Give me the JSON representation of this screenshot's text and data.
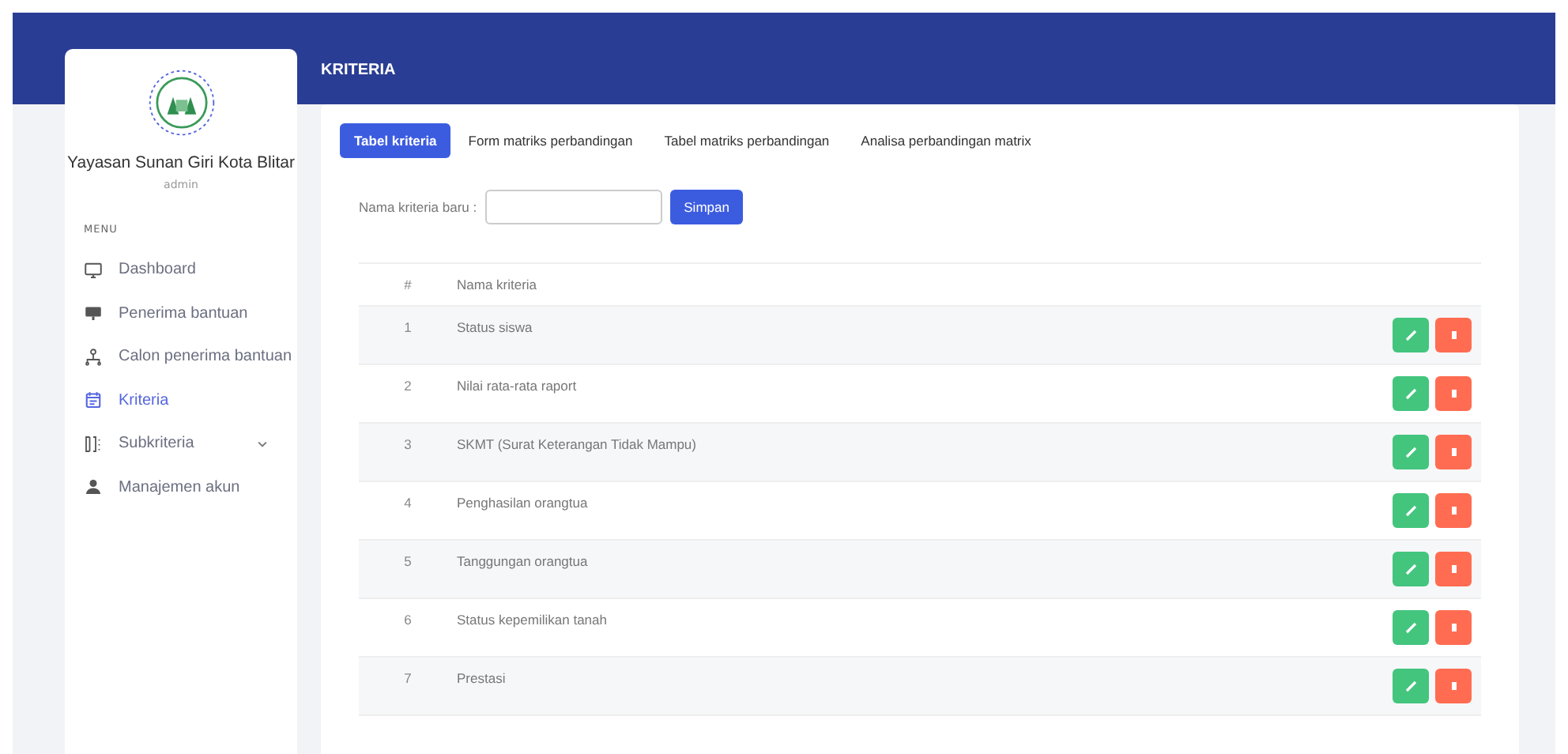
{
  "sidebar": {
    "org_name": "Yayasan Sunan Giri Kota Blitar",
    "role": "admin",
    "menu_heading": "MENU",
    "items": [
      {
        "label": "Dashboard",
        "kind": "monitor",
        "selected": false
      },
      {
        "label": "Penerima bantuan",
        "kind": "presentation",
        "selected": false
      },
      {
        "label": "Calon penerima bantuan",
        "kind": "network",
        "selected": false
      },
      {
        "label": "Kriteria",
        "kind": "calendar",
        "selected": true
      },
      {
        "label": "Subkriteria",
        "kind": "columns",
        "selected": false,
        "expanded": false
      },
      {
        "label": "Manajemen akun",
        "kind": "user",
        "selected": false
      }
    ]
  },
  "header": {
    "title": "KRITERIA"
  },
  "tabs": [
    {
      "label": "Tabel kriteria",
      "selected": true
    },
    {
      "label": "Form matriks perbandingan",
      "selected": false
    },
    {
      "label": "Tabel matriks perbandingan",
      "selected": false
    },
    {
      "label": "Analisa perbandingan matrix",
      "selected": false
    }
  ],
  "form": {
    "label": "Nama kriteria baru :",
    "button": "Simpan"
  },
  "table": {
    "columns": [
      "#",
      "Nama kriteria"
    ],
    "rows": [
      {
        "no": "1",
        "name": "Status siswa"
      },
      {
        "no": "2",
        "name": "Nilai rata-rata raport"
      },
      {
        "no": "3",
        "name": "SKMT (Surat Keterangan Tidak Mampu)"
      },
      {
        "no": "4",
        "name": "Penghasilan orangtua"
      },
      {
        "no": "5",
        "name": "Tanggungan orangtua"
      },
      {
        "no": "6",
        "name": "Status kepemilikan tanah"
      },
      {
        "no": "7",
        "name": "Prestasi"
      }
    ]
  }
}
